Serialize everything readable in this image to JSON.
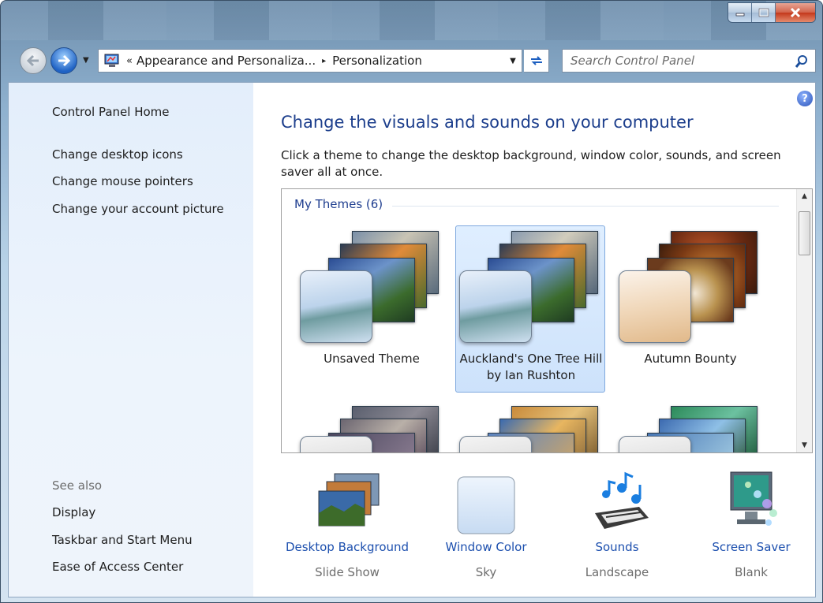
{
  "nav": {
    "back": "back-arrow-icon",
    "forward": "forward-arrow-icon",
    "crumb_chevrons": "«",
    "crumbs": [
      "Appearance and Personaliza...",
      "Personalization"
    ],
    "separator": "▸",
    "search_placeholder": "Search Control Panel"
  },
  "sidebar": {
    "home": "Control Panel Home",
    "links": [
      "Change desktop icons",
      "Change mouse pointers",
      "Change your account picture"
    ],
    "see_also_label": "See also",
    "see_also": [
      "Display",
      "Taskbar and Start Menu",
      "Ease of Access Center"
    ]
  },
  "main": {
    "heading": "Change the visuals and sounds on your computer",
    "description": "Click a theme to change the desktop background, window color, sounds, and screen saver all at once.",
    "group_title": "My Themes (6)",
    "themes": [
      {
        "name": "Unsaved Theme",
        "selected": false
      },
      {
        "name": "Auckland's One Tree Hill by Ian Rushton",
        "selected": true
      },
      {
        "name": "Autumn Bounty",
        "selected": false
      }
    ],
    "options": [
      {
        "label": "Desktop Background",
        "sub": "Slide Show"
      },
      {
        "label": "Window Color",
        "sub": "Sky"
      },
      {
        "label": "Sounds",
        "sub": "Landscape"
      },
      {
        "label": "Screen Saver",
        "sub": "Blank"
      }
    ]
  },
  "colors": {
    "link": "#1c4fae",
    "heading": "#1c3e8c",
    "selection": "#cde2fb",
    "sidebar": "#e3eefb"
  }
}
